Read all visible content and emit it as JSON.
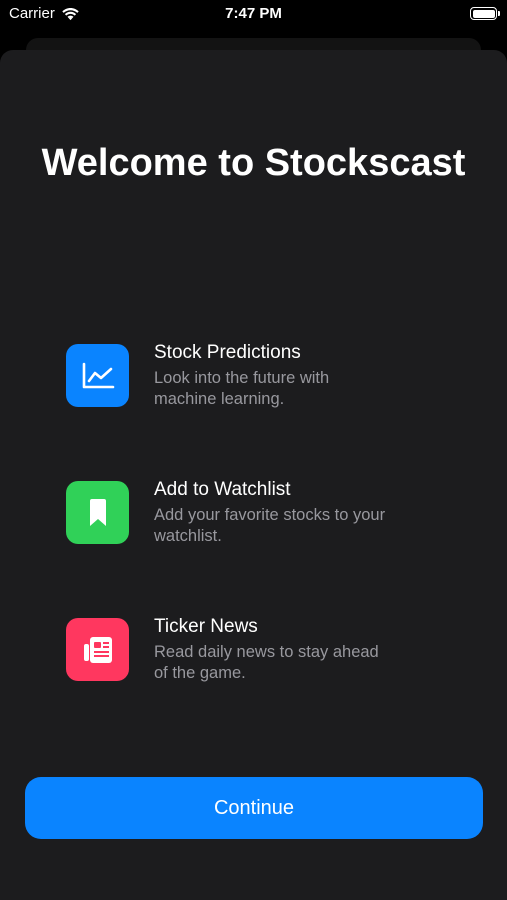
{
  "status_bar": {
    "carrier": "Carrier",
    "time": "7:47 PM"
  },
  "welcome": {
    "title": "Welcome to Stockscast"
  },
  "features": [
    {
      "icon": "chart-line-icon",
      "color": "#0a84ff",
      "title": "Stock Predictions",
      "description": "Look into the future with machine learning."
    },
    {
      "icon": "bookmark-icon",
      "color": "#30d158",
      "title": "Add to Watchlist",
      "description": "Add your favorite stocks to your watchlist."
    },
    {
      "icon": "newspaper-icon",
      "color": "#ff375f",
      "title": "Ticker News",
      "description": "Read daily news to stay ahead of the game."
    }
  ],
  "actions": {
    "continue_label": "Continue"
  }
}
